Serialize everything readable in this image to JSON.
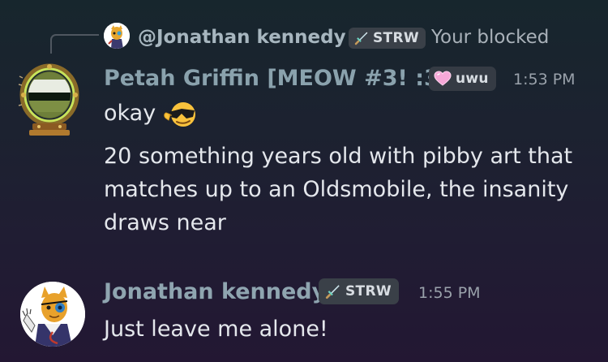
{
  "reply": {
    "username": "@Jonathan kennedy",
    "tag": "STRW",
    "preview": "Your blocked"
  },
  "message1": {
    "author": "Petah Griffin [MEOW #3! :3]",
    "tag": "uwu",
    "time": "1:53 PM",
    "line1": "okay",
    "line2": "20 something years old with pibby art that matches up to an Oldsmobile, the insanity draws near"
  },
  "message2": {
    "author": "Jonathan kennedy",
    "tag": "STRW",
    "time": "1:55 PM",
    "text": "Just leave me alone!"
  },
  "icons": {
    "reply_tag_icon": "sword-icon",
    "uwu_tag_icon": "pink-heart-icon",
    "reaction_emoji": "sunglasses-emoji-icon",
    "strw_tag_icon": "sword-icon"
  },
  "colors": {
    "author_color": "#8aa2ad",
    "tag_bg": "#3a4048",
    "heart": "#f7a8d8"
  }
}
